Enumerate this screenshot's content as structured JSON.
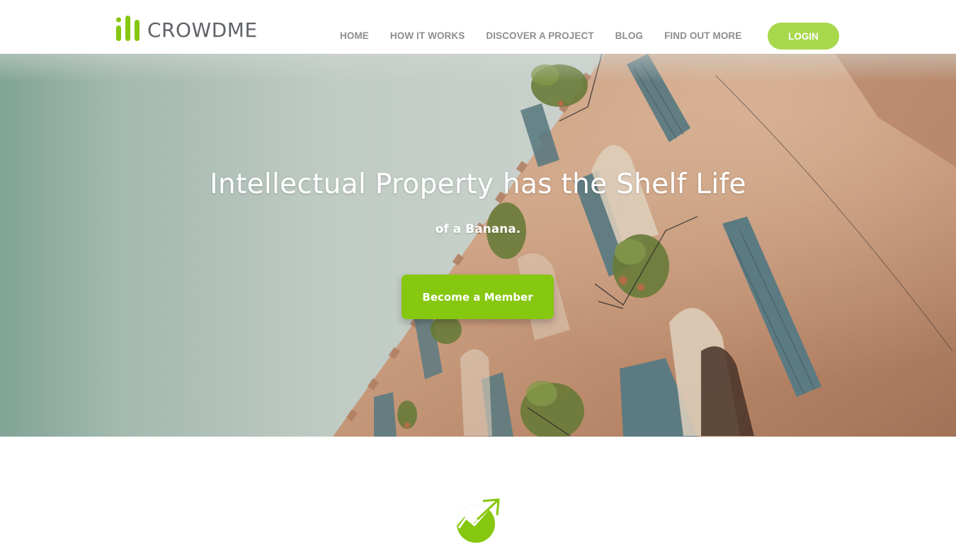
{
  "brand": {
    "name": "CROWDME",
    "accent_color": "#86c70f",
    "logo_icon": "bar-chart-logo-icon"
  },
  "nav": {
    "items": [
      {
        "label": "HOME"
      },
      {
        "label": "HOW IT WORKS"
      },
      {
        "label": "DISCOVER A PROJECT"
      },
      {
        "label": "BLOG"
      },
      {
        "label": "FIND OUT MORE"
      }
    ],
    "login_label": "LOGIN",
    "login_color": "#a8d84c"
  },
  "hero": {
    "title": "Intellectual Property has the Shelf Life",
    "subtitle": "of a Banana.",
    "cta_label": "Become a Member",
    "cta_color": "#86c70f"
  },
  "section": {
    "icon": "growth-arrow-icon"
  }
}
